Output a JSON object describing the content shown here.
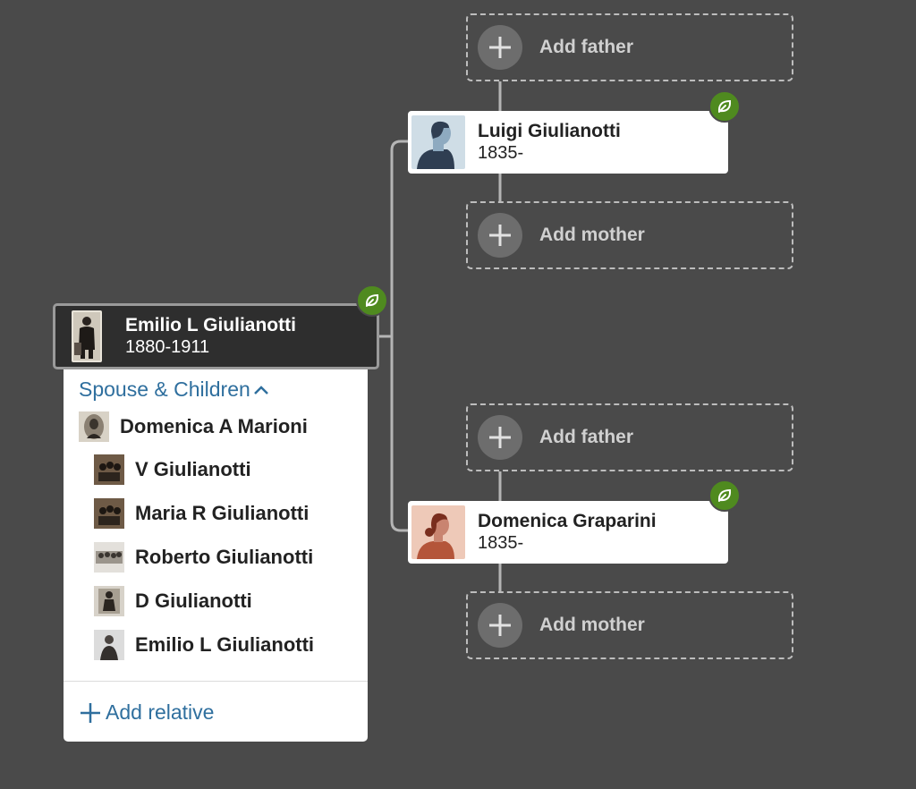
{
  "colors": {
    "background": "#4a4a4a",
    "card": "#ffffff",
    "focus_card": "#2e2e2e",
    "hint_badge": "#4f8a1f",
    "link": "#2f6f9e"
  },
  "icons": {
    "add": "plus-icon",
    "hint": "leaf-icon",
    "collapse": "chevron-up-icon"
  },
  "tree": {
    "focus_person": {
      "name": "Emilio L Giulianotti",
      "dates": "1880-1911"
    },
    "father": {
      "name": "Luigi Giulianotti",
      "dates": "1835-"
    },
    "mother": {
      "name": "Domenica Graparini",
      "dates": "1835-"
    },
    "add_father_label": "Add father",
    "add_mother_label": "Add mother"
  },
  "family_panel": {
    "header": "Spouse & Children",
    "spouse": {
      "name": "Domenica A Marioni"
    },
    "children": [
      {
        "name": "V Giulianotti"
      },
      {
        "name": "Maria R Giulianotti"
      },
      {
        "name": "Roberto Giulianotti"
      },
      {
        "name": "D Giulianotti"
      },
      {
        "name": "Emilio L Giulianotti"
      }
    ],
    "add_relative_label": "Add relative"
  }
}
